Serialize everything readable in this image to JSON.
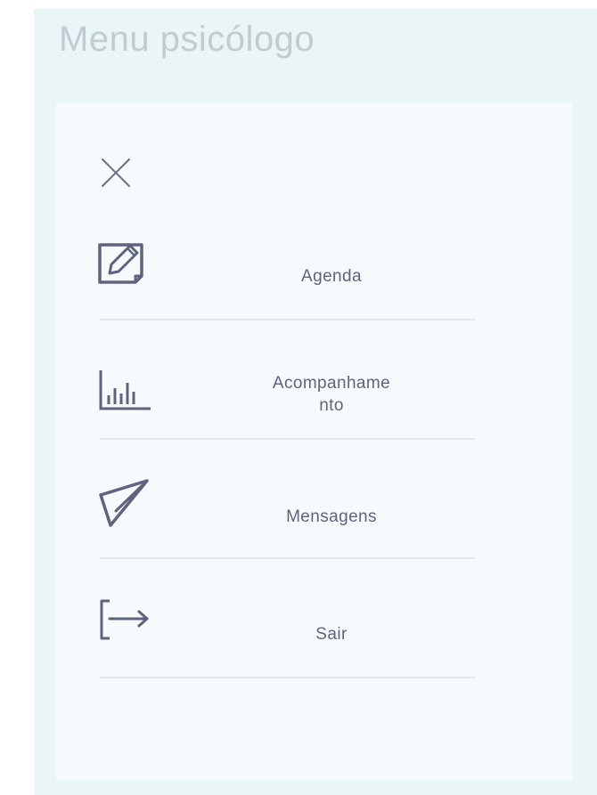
{
  "page": {
    "title": "Menu psicólogo"
  },
  "menu": {
    "close_icon": "close-icon",
    "items": [
      {
        "id": "agenda",
        "label": "Agenda",
        "icon": "edit-note-icon"
      },
      {
        "id": "acompanhamento",
        "label": "Acompanhame\nnto",
        "icon": "bar-chart-icon"
      },
      {
        "id": "mensagens",
        "label": "Mensagens",
        "icon": "paper-plane-icon"
      },
      {
        "id": "sair",
        "label": "Sair",
        "icon": "logout-icon"
      }
    ]
  },
  "colors": {
    "background": "#eaf5f8",
    "panel": "#f6fafc",
    "title": "#c4cbd0",
    "text": "#5e6380",
    "icon": "#5e6380",
    "divider": "#e2e5ea"
  }
}
